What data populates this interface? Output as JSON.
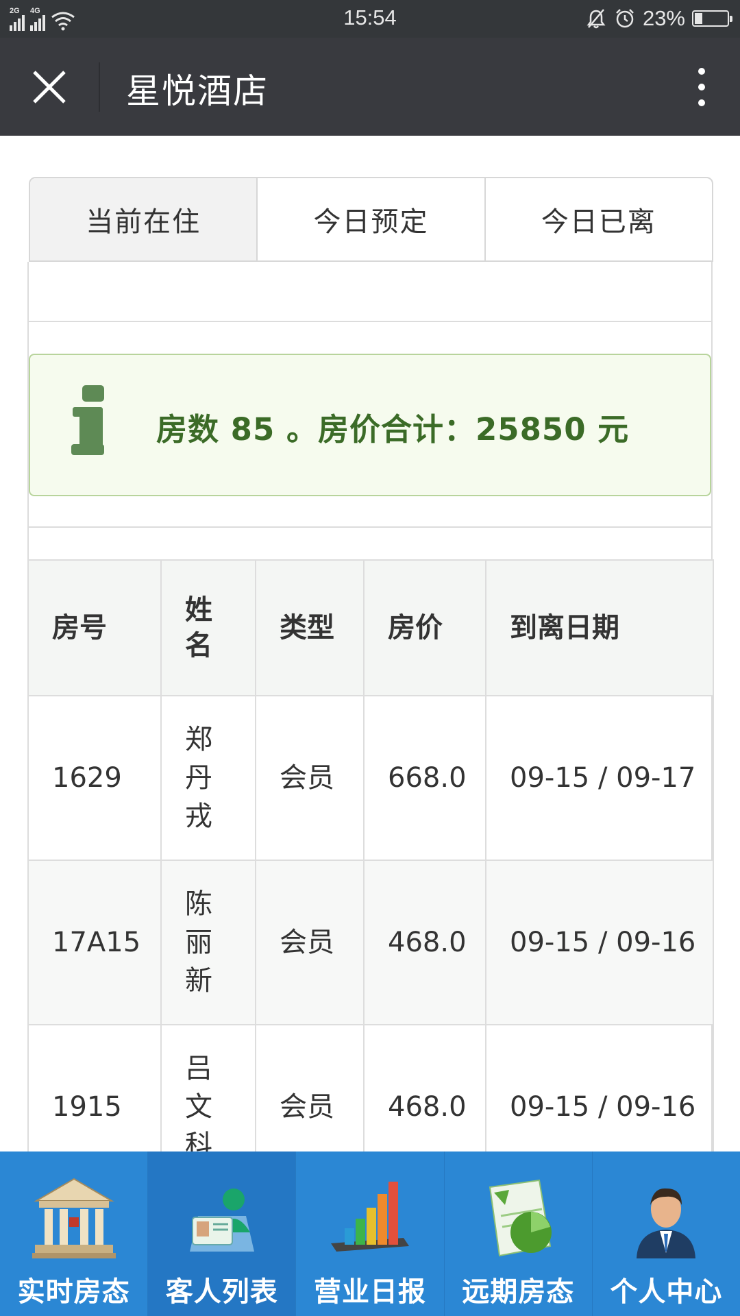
{
  "status_bar": {
    "network1": "2G",
    "network2": "4G",
    "time": "15:54",
    "battery_percent_label": "23%",
    "battery_level": 0.23
  },
  "titlebar": {
    "title": "星悦酒店",
    "close_icon": "close-icon",
    "more_icon": "more-vertical-icon"
  },
  "tabs": [
    {
      "label": "当前在住",
      "active": true
    },
    {
      "label": "今日预定",
      "active": false
    },
    {
      "label": "今日已离",
      "active": false
    }
  ],
  "alert": {
    "icon": "info-icon",
    "text": "房数 85 。房价合计：25850 元",
    "colors": {
      "background": "#f6fbee",
      "border": "#b8d49c",
      "text": "#3b6b27"
    }
  },
  "table": {
    "headers": [
      "房号",
      "姓名",
      "类型",
      "房价",
      "到离日期"
    ],
    "rows": [
      {
        "room": "1629",
        "name": "郑丹戎",
        "type": "会员",
        "price": "668.0",
        "dates": "09-15 / 09-17"
      },
      {
        "room": "17A15",
        "name": "陈丽新",
        "type": "会员",
        "price": "468.0",
        "dates": "09-15 / 09-16"
      },
      {
        "room": "1915",
        "name": "吕文科",
        "type": "会员",
        "price": "468.0",
        "dates": "09-15 / 09-16"
      }
    ]
  },
  "bottom_nav": [
    {
      "label": "实时房态",
      "icon": "building-icon",
      "active": false
    },
    {
      "label": "客人列表",
      "icon": "guest-card-icon",
      "active": true
    },
    {
      "label": "营业日报",
      "icon": "bar-chart-icon",
      "active": false
    },
    {
      "label": "远期房态",
      "icon": "spreadsheet-chart-icon",
      "active": false
    },
    {
      "label": "个人中心",
      "icon": "user-avatar-icon",
      "active": false
    }
  ],
  "colors": {
    "titlebar": "#393a3f",
    "status_bar": "#34373a",
    "nav_bar": "#2b87d4",
    "nav_active": "#2477c4"
  }
}
